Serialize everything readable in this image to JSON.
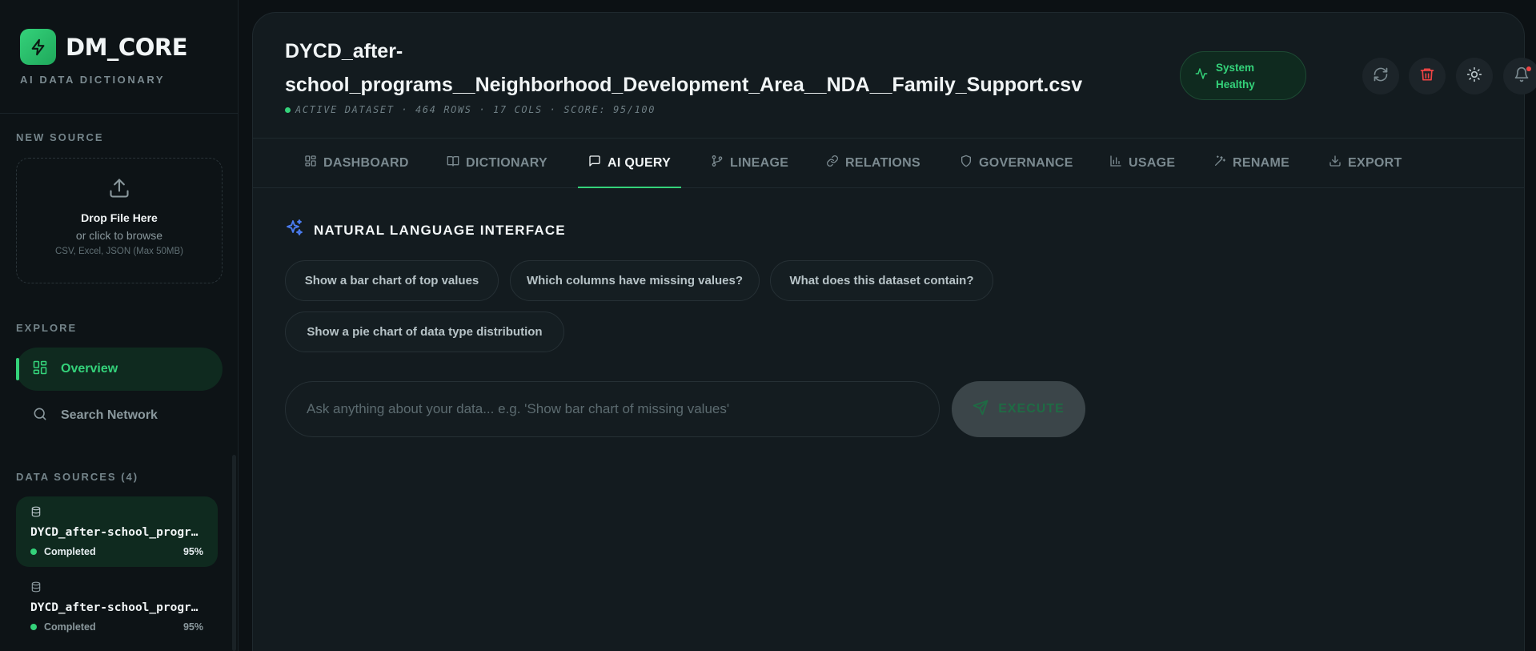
{
  "brand": {
    "name": "DM_CORE",
    "subtitle": "AI DATA DICTIONARY"
  },
  "sidebar": {
    "new_source_label": "NEW SOURCE",
    "dropzone": {
      "title": "Drop File Here",
      "subtitle": "or click to browse",
      "hint": "CSV, Excel, JSON (Max 50MB)"
    },
    "explore_label": "EXPLORE",
    "nav": [
      {
        "label": "Overview",
        "icon": "grid-icon"
      },
      {
        "label": "Search Network",
        "icon": "search-icon"
      }
    ],
    "data_sources_label": "DATA SOURCES (4)",
    "data_sources": [
      {
        "name": "DYCD_after-school_programs__Neighborhood_Development_Area__NDA__Family_Support.csv",
        "status": "Completed",
        "progress": "95%"
      },
      {
        "name": "DYCD_after-school_programs__Neighborhood_Development_Area__NDA__Family_Support.csv",
        "status": "Completed",
        "progress": "95%"
      }
    ]
  },
  "header": {
    "title": "DYCD_after-school_programs__Neighborhood_Development_Area__NDA__Family_Support.csv",
    "meta": "ACTIVE DATASET · 464 ROWS · 17 COLS · SCORE: 95/100",
    "health": "System Healthy"
  },
  "tabs": [
    {
      "label": "DASHBOARD",
      "icon": "dashboard-icon"
    },
    {
      "label": "DICTIONARY",
      "icon": "book-icon"
    },
    {
      "label": "AI QUERY",
      "icon": "chat-icon"
    },
    {
      "label": "LINEAGE",
      "icon": "git-branch-icon"
    },
    {
      "label": "RELATIONS",
      "icon": "link-icon"
    },
    {
      "label": "GOVERNANCE",
      "icon": "shield-icon"
    },
    {
      "label": "USAGE",
      "icon": "bar-chart-icon"
    },
    {
      "label": "RENAME",
      "icon": "magic-wand-icon"
    },
    {
      "label": "EXPORT",
      "icon": "download-icon"
    }
  ],
  "active_tab": "AI QUERY",
  "query": {
    "section_title": "NATURAL LANGUAGE INTERFACE",
    "suggestions": [
      "Show a bar chart of top values",
      "Which columns have missing values?",
      "What does this dataset contain?",
      "Show a pie chart of data type distribution"
    ],
    "input_value": "",
    "placeholder": "Ask anything about your data... e.g. 'Show bar chart of missing values'",
    "execute_label": "EXECUTE"
  },
  "colors": {
    "accent": "#34d27a",
    "background": "#0c1114",
    "panel": "#131b1f",
    "danger": "#ef4444",
    "ai_icon": "#4a7cf0"
  }
}
